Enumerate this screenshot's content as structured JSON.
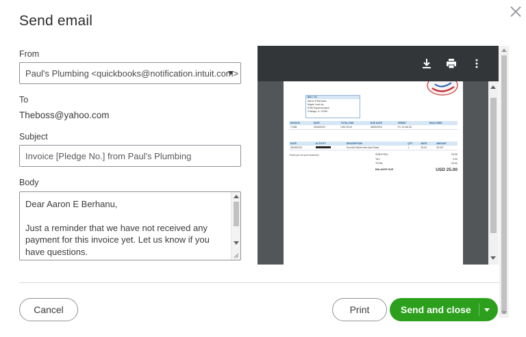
{
  "dialog": {
    "title": "Send email"
  },
  "from": {
    "label": "From",
    "value": "Paul's Plumbing <quickbooks@notification.intuit.com>"
  },
  "to": {
    "label": "To",
    "value": "Theboss@yahoo.com"
  },
  "subject": {
    "label": "Subject",
    "value": "Invoice [Pledge No.] from Paul's Plumbing"
  },
  "body": {
    "label": "Body",
    "greeting": "Dear Aaron E Berhanu,",
    "message": "Just a reminder that we have not received any payment for this invoice yet.  Let us know if you have questions."
  },
  "preview": {
    "toolbar": {
      "download_icon": "download-icon",
      "print_icon": "print-icon",
      "more_icon": "more-vertical-icon"
    },
    "bill_to": {
      "header": "BILL TO",
      "lines": [
        "Aaron E Berhanu",
        "Maple Leaf Inc.",
        "6789 Supercoreport",
        "Chicago, IL 12345"
      ]
    },
    "invoice_table": {
      "headers": [
        "INVOICE",
        "DATE",
        "TOTAL DUE",
        "DUE DATE",
        "TERMS",
        "ENCLOSED"
      ],
      "row": [
        "71356",
        "05/18/2023",
        "USD 25.00",
        "06/09/2023",
        "Fri, 13 Net 30",
        ""
      ]
    },
    "items_table": {
      "headers": [
        "DATE",
        "ACTIVITY",
        "DESCRIPTION",
        "QTY",
        "RATE",
        "AMOUNT"
      ],
      "row": [
        "05/18/2023",
        "",
        "Scorned Nickel with Opal Glass",
        "1",
        "25.00",
        "25.00T"
      ]
    },
    "thanks": "Thank you for your business!",
    "totals": [
      {
        "label": "SUBTOTAL",
        "value": "25.00"
      },
      {
        "label": "TAX",
        "value": "0.00"
      },
      {
        "label": "TOTAL",
        "value": "25.00"
      }
    ],
    "balance_due": {
      "label": "BALANCE DUE",
      "value": "USD 25.00"
    }
  },
  "buttons": {
    "cancel": "Cancel",
    "print": "Print",
    "send": "Send and close"
  },
  "colors": {
    "primary_green": "#2ca01c",
    "preview_toolbar": "#323639",
    "preview_bg": "#525659"
  }
}
